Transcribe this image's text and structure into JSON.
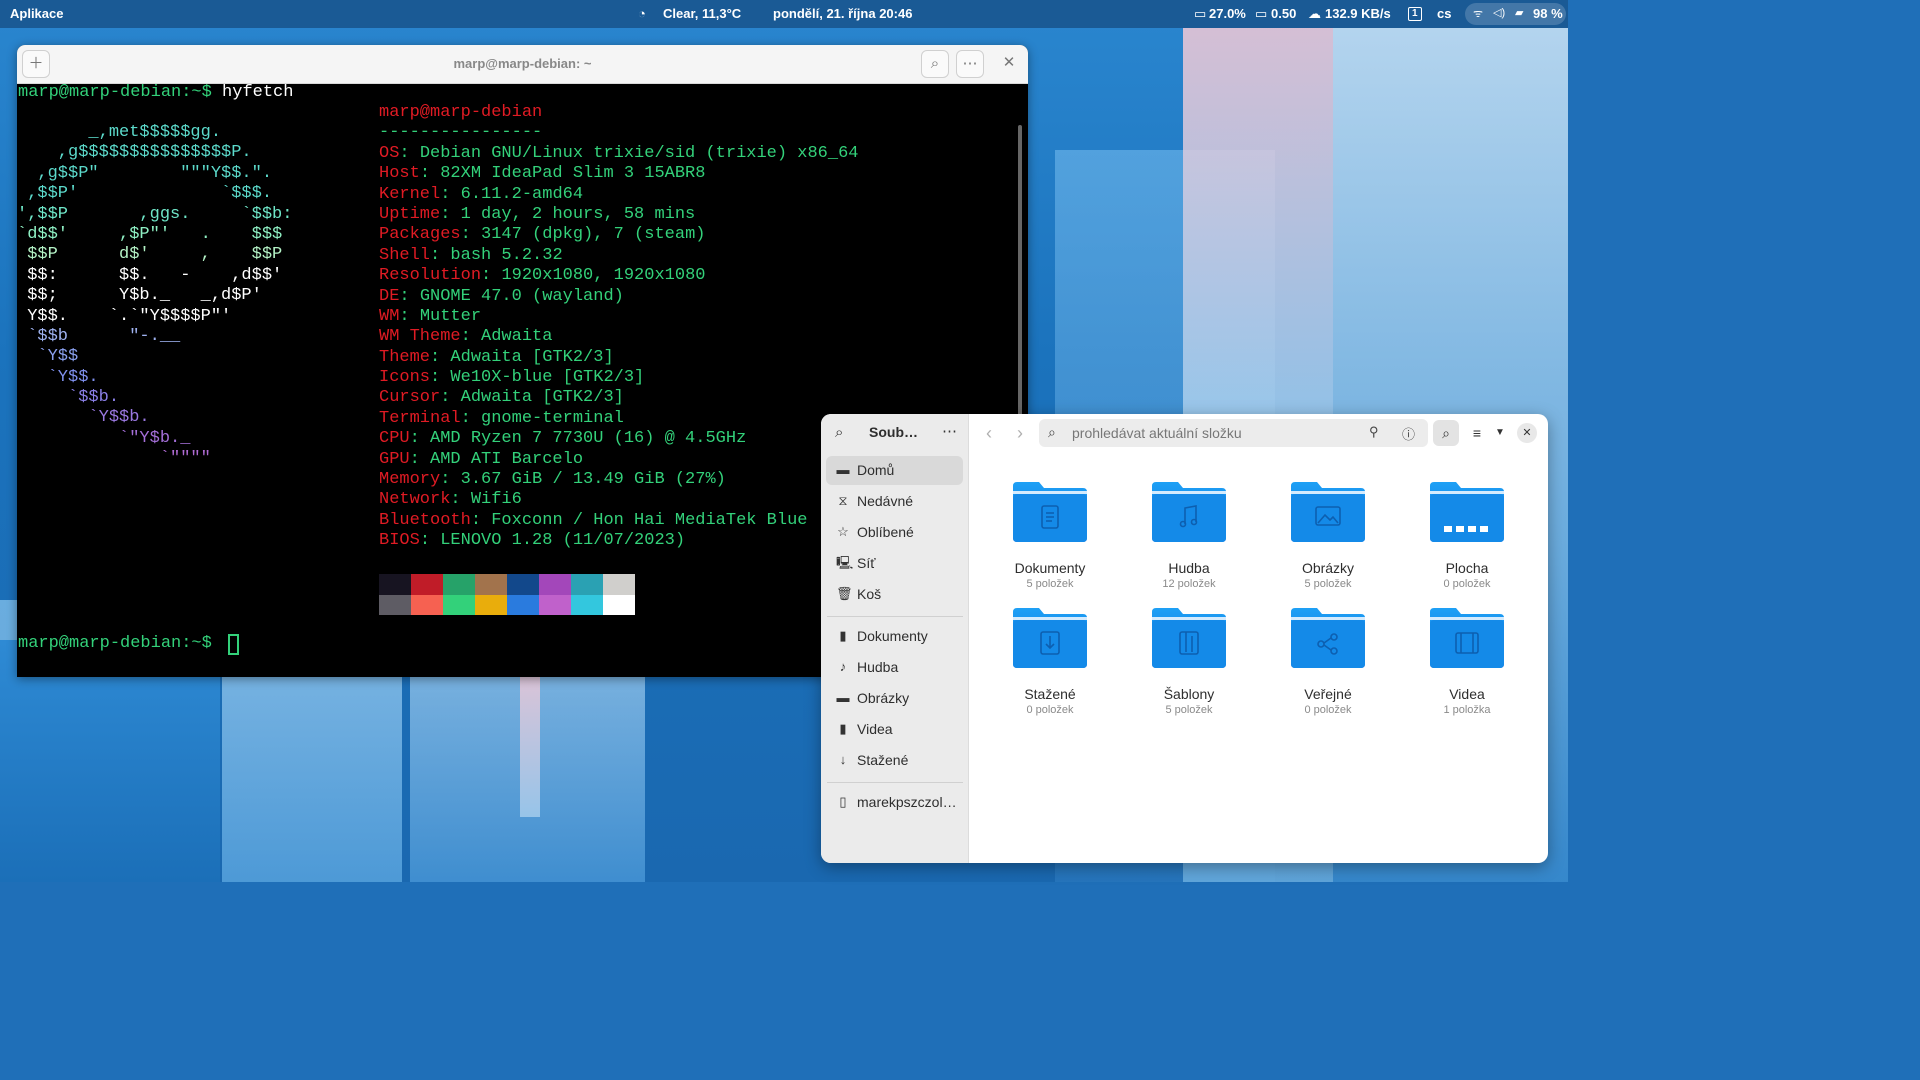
{
  "topbar": {
    "apps": "Aplikace",
    "weather": "Clear, 11,3°C",
    "datetime": "pondělí, 21. října  20:46",
    "cpu": "27.0%",
    "load": "0.50",
    "net": "132.9 KB/s",
    "workspace": "1",
    "lang": "cs",
    "battery": "98 %"
  },
  "terminal": {
    "title": "marp@marp-debian: ~",
    "prompt1": "marp@marp-debian:~$ ",
    "command": "hyfetch",
    "prompt2": "marp@marp-debian:~$ ",
    "art": [
      "       _,met$$$$$gg.",
      "    ,g$$$$$$$$$$$$$$$P.",
      "  ,g$$P\"        \"\"\"Y$$.\".",
      " ,$$P'              `$$$.",
      "',$$P       ,ggs.     `$$b:",
      "`d$$'     ,$P\"'   .    $$$",
      " $$P      d$'     ,    $$P",
      " $$:      $$.   -    ,d$$'",
      " $$;      Y$b._   _,d$P'",
      " Y$$.    `.`\"Y$$$$P\"'",
      " `$$b      \"-.__",
      "  `Y$$",
      "   `Y$$.",
      "     `$$b.",
      "       `Y$$b.",
      "          `\"Y$b._",
      "              `\"\"\"\""
    ],
    "art_colors": [
      "#5cdacb",
      "#5cdacb",
      "#5cdacb",
      "#5cdacb",
      "#6fe6c8",
      "#8ff0c4",
      "#b4f2c6",
      "#ffffff",
      "#ffffff",
      "#ffffff",
      "#9fb2f0",
      "#8aa0ef",
      "#7f90ee",
      "#8a7fe6",
      "#9a78e0",
      "#a46fd8",
      "#b06bd3"
    ],
    "user": "marp@marp-debian",
    "separator": "----------------",
    "info": [
      {
        "key": "OS",
        "value": "Debian GNU/Linux trixie/sid (trixie) x86_64"
      },
      {
        "key": "Host",
        "value": "82XM IdeaPad Slim 3 15ABR8"
      },
      {
        "key": "Kernel",
        "value": "6.11.2-amd64"
      },
      {
        "key": "Uptime",
        "value": "1 day, 2 hours, 58 mins"
      },
      {
        "key": "Packages",
        "value": "3147 (dpkg), 7 (steam)"
      },
      {
        "key": "Shell",
        "value": "bash 5.2.32"
      },
      {
        "key": "Resolution",
        "value": "1920x1080, 1920x1080"
      },
      {
        "key": "DE",
        "value": "GNOME 47.0 (wayland)"
      },
      {
        "key": "WM",
        "value": "Mutter"
      },
      {
        "key": "WM Theme",
        "value": "Adwaita"
      },
      {
        "key": "Theme",
        "value": "Adwaita [GTK2/3]"
      },
      {
        "key": "Icons",
        "value": "We10X-blue [GTK2/3]"
      },
      {
        "key": "Cursor",
        "value": "Adwaita [GTK2/3]"
      },
      {
        "key": "Terminal",
        "value": "gnome-terminal"
      },
      {
        "key": "CPU",
        "value": "AMD Ryzen 7 7730U (16) @ 4.5GHz"
      },
      {
        "key": "GPU",
        "value": "AMD ATI Barcelo"
      },
      {
        "key": "Memory",
        "value": "3.67 GiB / 13.49 GiB (27%)"
      },
      {
        "key": "Network",
        "value": "Wifi6"
      },
      {
        "key": "Bluetooth",
        "value": "Foxconn / Hon Hai MediaTek Blue"
      },
      {
        "key": "BIOS",
        "value": "LENOVO 1.28 (11/07/2023)"
      }
    ],
    "palette_dark": [
      "#171421",
      "#c01c28",
      "#26a269",
      "#a2734c",
      "#12488b",
      "#a347ba",
      "#2aa1b3",
      "#d0cfcc"
    ],
    "palette_bright": [
      "#5e5c64",
      "#f66151",
      "#33d17a",
      "#e9ad0c",
      "#2a7bde",
      "#c061cb",
      "#33c7de",
      "#ffffff"
    ]
  },
  "files": {
    "title": "Soub…",
    "search_placeholder": "prohledávat aktuální složku",
    "places": [
      {
        "icon": "home-icon",
        "glyph": "▬",
        "label": "Domů"
      },
      {
        "icon": "recent-icon",
        "glyph": "⧖",
        "label": "Nedávné"
      },
      {
        "icon": "star-icon",
        "glyph": "☆",
        "label": "Oblíbené"
      },
      {
        "icon": "network-icon",
        "glyph": "🖳",
        "label": "Síť"
      },
      {
        "icon": "trash-icon",
        "glyph": "🗑",
        "label": "Koš"
      }
    ],
    "bookmarks": [
      {
        "icon": "document-icon",
        "glyph": "▮",
        "label": "Dokumenty"
      },
      {
        "icon": "music-icon",
        "glyph": "♪",
        "label": "Hudba"
      },
      {
        "icon": "picture-icon",
        "glyph": "▬",
        "label": "Obrázky"
      },
      {
        "icon": "video-icon",
        "glyph": "▮",
        "label": "Videa"
      },
      {
        "icon": "download-icon",
        "glyph": "↓",
        "label": "Stažené"
      }
    ],
    "drive": {
      "icon": "drive-icon",
      "glyph": "▯",
      "label": "marekpszczol…"
    },
    "folders": [
      {
        "name": "Dokumenty",
        "count": "5 položek",
        "symbol": "doc"
      },
      {
        "name": "Hudba",
        "count": "12 položek",
        "symbol": "music"
      },
      {
        "name": "Obrázky",
        "count": "5 položek",
        "symbol": "picture"
      },
      {
        "name": "Plocha",
        "count": "0 položek",
        "symbol": "desktop"
      },
      {
        "name": "Stažené",
        "count": "0 položek",
        "symbol": "download"
      },
      {
        "name": "Šablony",
        "count": "5 položek",
        "symbol": "template"
      },
      {
        "name": "Veřejné",
        "count": "0 položek",
        "symbol": "share"
      },
      {
        "name": "Videa",
        "count": "1 položka",
        "symbol": "video"
      }
    ]
  }
}
